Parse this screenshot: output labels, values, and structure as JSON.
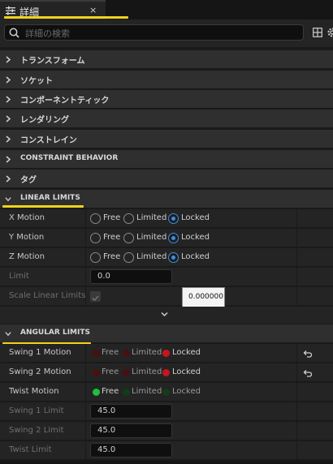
{
  "tab": {
    "title": "詳細",
    "close": "×"
  },
  "search": {
    "placeholder": "詳細の検索"
  },
  "sections": {
    "transform": "トランスフォーム",
    "socket": "ソケット",
    "component_tick": "コンポーネントティック",
    "rendering": "レンダリング",
    "constraint": "コンストレイン",
    "constraint_behavior": "CONSTRAINT BEHAVIOR",
    "tags": "タグ",
    "linear_limits": "LINEAR LIMITS",
    "angular_limits": "ANGULAR LIMITS"
  },
  "options": {
    "free": "Free",
    "limited": "Limited",
    "locked": "Locked"
  },
  "linear": {
    "x_motion": {
      "label": "X Motion",
      "selected": "Locked"
    },
    "y_motion": {
      "label": "Y Motion",
      "selected": "Locked"
    },
    "z_motion": {
      "label": "Z Motion",
      "selected": "Locked"
    },
    "limit": {
      "label": "Limit",
      "value": "0.0"
    },
    "scale_linear_limits": {
      "label": "Scale Linear Limits",
      "checked": true
    },
    "tooltip_value": "0.000000"
  },
  "angular": {
    "swing1_motion": {
      "label": "Swing 1 Motion",
      "selected": "Locked"
    },
    "swing2_motion": {
      "label": "Swing 2 Motion",
      "selected": "Locked"
    },
    "twist_motion": {
      "label": "Twist Motion",
      "selected": "Free"
    },
    "swing1_limit": {
      "label": "Swing 1 Limit",
      "value": "45.0"
    },
    "swing2_limit": {
      "label": "Swing 2 Limit",
      "value": "45.0"
    },
    "twist_limit": {
      "label": "Twist Limit",
      "value": "45.0"
    }
  },
  "icons": {
    "tab": "details-icon",
    "search": "search-icon",
    "grid": "grid-icon",
    "settings": "gear-icon",
    "reset": "reset-arrow-icon",
    "expand": "chevron-down-icon"
  },
  "colors": {
    "accent_blue": "#3d8ee0",
    "locked_red": "#c8141e",
    "free_green": "#1fbf3a",
    "highlight": "#f2d21b"
  }
}
